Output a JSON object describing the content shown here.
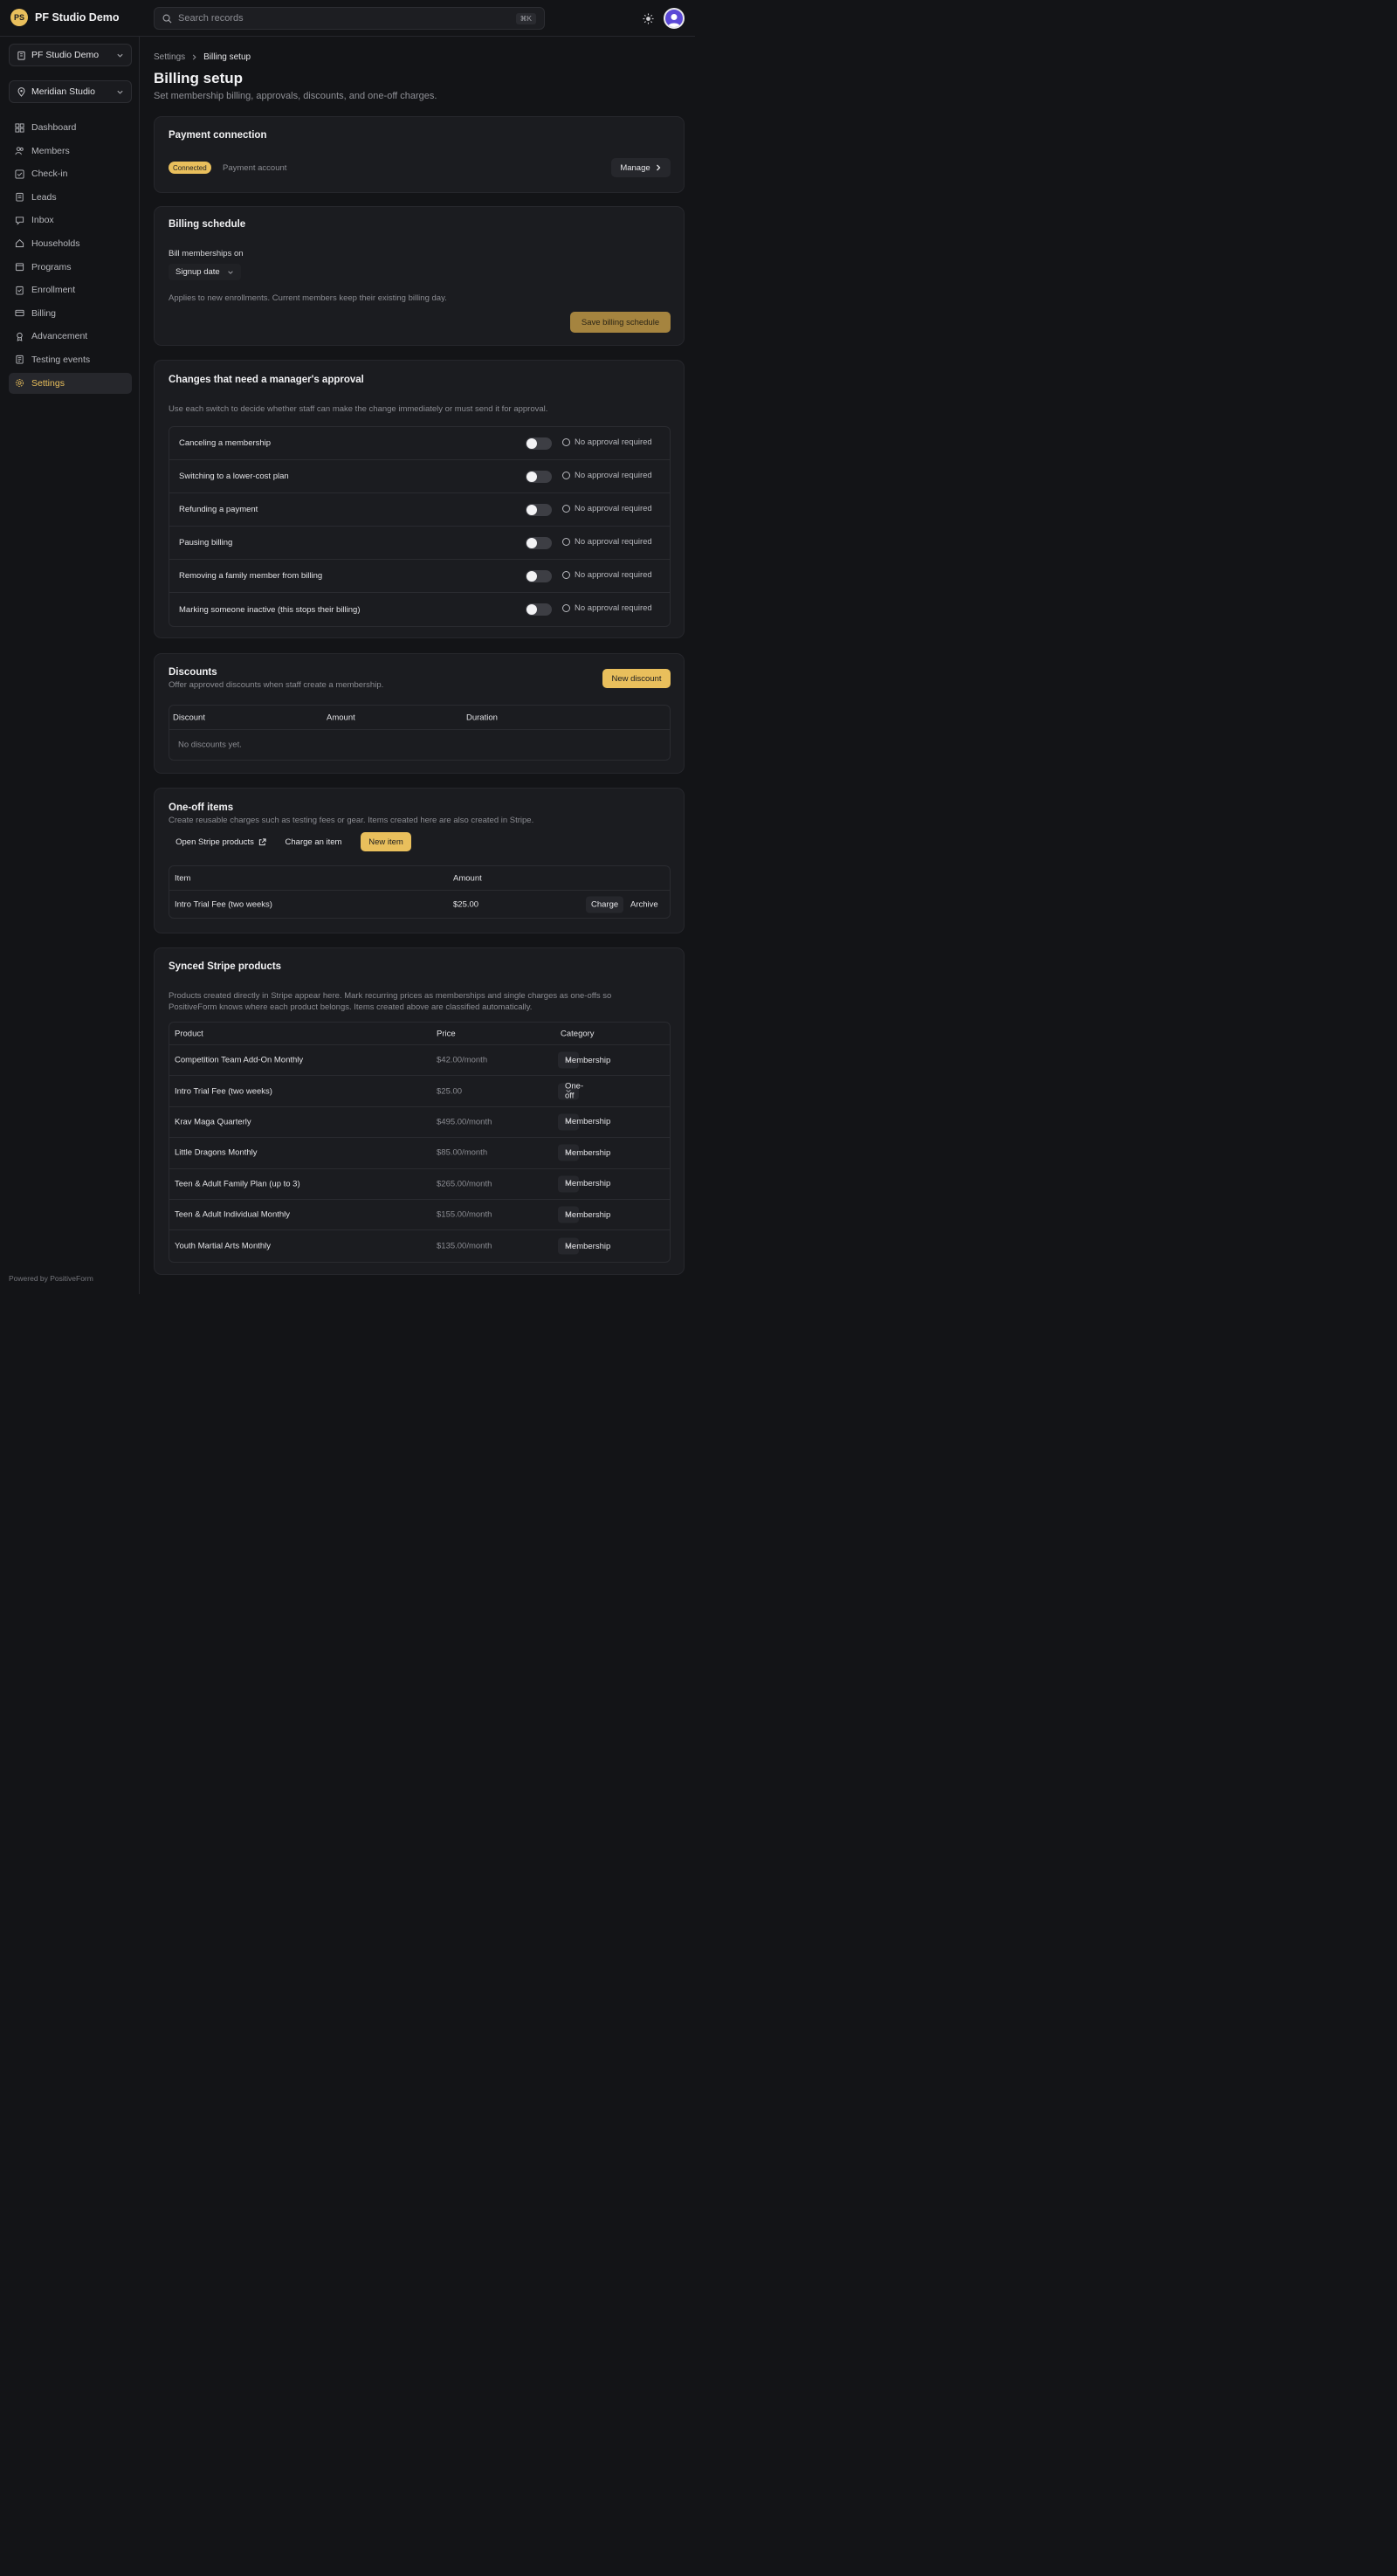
{
  "header": {
    "brand_initials": "PS",
    "brand_name": "PF Studio Demo",
    "search_placeholder": "Search records",
    "search_shortcut": "⌘K"
  },
  "sidebar": {
    "org_selector": "PF Studio Demo",
    "location_selector": "Meridian Studio",
    "items": [
      {
        "label": "Dashboard",
        "icon": "dashboard-icon"
      },
      {
        "label": "Members",
        "icon": "members-icon"
      },
      {
        "label": "Check-in",
        "icon": "check-in-icon"
      },
      {
        "label": "Leads",
        "icon": "leads-icon"
      },
      {
        "label": "Inbox",
        "icon": "inbox-icon"
      },
      {
        "label": "Households",
        "icon": "households-icon"
      },
      {
        "label": "Programs",
        "icon": "programs-icon"
      },
      {
        "label": "Enrollment",
        "icon": "enrollment-icon"
      },
      {
        "label": "Billing",
        "icon": "billing-icon"
      },
      {
        "label": "Advancement",
        "icon": "advancement-icon"
      },
      {
        "label": "Testing events",
        "icon": "testing-events-icon"
      },
      {
        "label": "Settings",
        "icon": "settings-icon",
        "active": true
      }
    ],
    "powered_by": "Powered by PositiveForm"
  },
  "breadcrumb": {
    "parent": "Settings",
    "current": "Billing setup"
  },
  "page": {
    "title": "Billing setup",
    "subtitle": "Set membership billing, approvals, discounts, and one-off charges."
  },
  "payment_connection": {
    "title": "Payment connection",
    "status": "Connected",
    "label": "Payment account",
    "manage_label": "Manage"
  },
  "billing_schedule": {
    "title": "Billing schedule",
    "field_label": "Bill memberships on",
    "field_value": "Signup date",
    "help": "Applies to new enrollments. Current members keep their existing billing day.",
    "save_label": "Save billing schedule"
  },
  "approvals": {
    "title": "Changes that need a manager's approval",
    "description": "Use each switch to decide whether staff can make the change immediately or must send it for approval.",
    "rows": [
      {
        "label": "Canceling a membership",
        "status": "No approval required"
      },
      {
        "label": "Switching to a lower-cost plan",
        "status": "No approval required"
      },
      {
        "label": "Refunding a payment",
        "status": "No approval required"
      },
      {
        "label": "Pausing billing",
        "status": "No approval required"
      },
      {
        "label": "Removing a family member from billing",
        "status": "No approval required"
      },
      {
        "label": "Marking someone inactive (this stops their billing)",
        "status": "No approval required"
      }
    ]
  },
  "discounts": {
    "title": "Discounts",
    "description": "Offer approved discounts when staff create a membership.",
    "new_label": "New discount",
    "columns": [
      "Discount",
      "Amount",
      "Duration"
    ],
    "empty": "No discounts yet."
  },
  "one_off": {
    "title": "One-off items",
    "description": "Create reusable charges such as testing fees or gear. Items created here are also created in Stripe.",
    "open_stripe_label": "Open Stripe products",
    "charge_label": "Charge an item",
    "new_label": "New item",
    "columns": [
      "Item",
      "Amount"
    ],
    "rows": [
      {
        "item": "Intro Trial Fee (two weeks)",
        "amount": "$25.00",
        "charge": "Charge",
        "archive": "Archive"
      }
    ]
  },
  "synced": {
    "title": "Synced Stripe products",
    "description_line1": "Products created directly in Stripe appear here. Mark recurring prices as memberships and single charges as one-offs so",
    "description_line2": "PositiveForm knows where each product belongs. Items created above are classified automatically.",
    "columns": [
      "Product",
      "Price",
      "Category"
    ],
    "rows": [
      {
        "product": "Competition Team Add-On Monthly",
        "price": "$42.00/month",
        "category": "Membership"
      },
      {
        "product": "Intro Trial Fee (two weeks)",
        "price": "$25.00",
        "category": "One-off"
      },
      {
        "product": "Krav Maga Quarterly",
        "price": "$495.00/month",
        "category": "Membership"
      },
      {
        "product": "Little Dragons Monthly",
        "price": "$85.00/month",
        "category": "Membership"
      },
      {
        "product": "Teen & Adult Family Plan (up to 3)",
        "price": "$265.00/month",
        "category": "Membership"
      },
      {
        "product": "Teen & Adult Individual Monthly",
        "price": "$155.00/month",
        "category": "Membership"
      },
      {
        "product": "Youth Martial Arts Monthly",
        "price": "$135.00/month",
        "category": "Membership"
      }
    ]
  },
  "colors": {
    "accent": "#e9bf5c",
    "background": "#131417",
    "card": "#1b1c20"
  }
}
